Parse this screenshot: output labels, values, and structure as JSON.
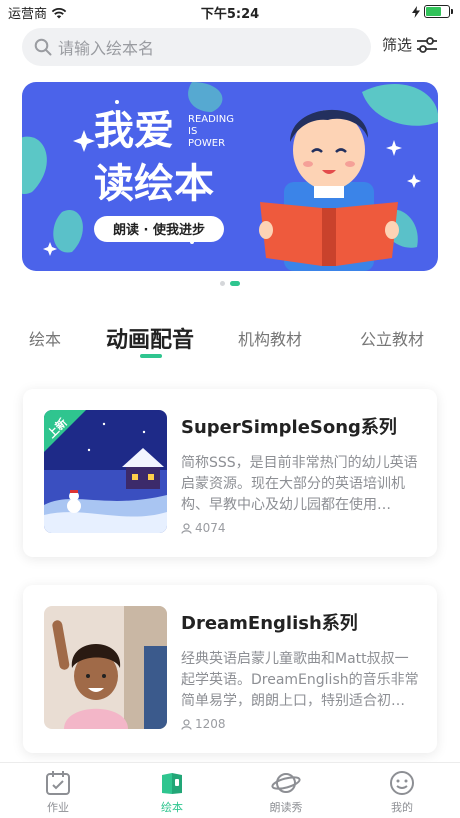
{
  "status_bar": {
    "carrier": "运营商",
    "time": "下午5:24"
  },
  "search": {
    "placeholder": "请输入绘本名",
    "filter_label": "筛选"
  },
  "banner": {
    "title_line1": "我爱",
    "title_line2": "读绘本",
    "slogan_en_1": "READING",
    "slogan_en_2": "IS",
    "slogan_en_3": "POWER",
    "pill_text": "朗读 · 使我进步",
    "active_page": 2,
    "page_count": 2
  },
  "tabs": [
    {
      "label": "绘本",
      "active": false
    },
    {
      "label": "动画配音",
      "active": true
    },
    {
      "label": "机构教材",
      "active": false
    },
    {
      "label": "公立教材",
      "active": false
    }
  ],
  "cards": [
    {
      "badge": "上新",
      "title": "SuperSimpleSong系列",
      "description": "简称SSS，是目前非常热门的幼儿英语启蒙资源。现在大部分的英语培训机构、早教中心及幼儿园都在使用…",
      "count": "4074"
    },
    {
      "title": "DreamEnglish系列",
      "description": "经典英语启蒙儿童歌曲和Matt叔叔一起学英语。DreamEnglish的音乐非常简单易学，朗朗上口，特别适合初…",
      "count": "1208"
    }
  ],
  "tabbar": [
    {
      "label": "作业",
      "icon": "homework-calendar-icon",
      "active": false
    },
    {
      "label": "绘本",
      "icon": "picture-book-icon",
      "active": true
    },
    {
      "label": "朗读秀",
      "icon": "planet-icon",
      "active": false
    },
    {
      "label": "我的",
      "icon": "smiley-face-icon",
      "active": false
    }
  ],
  "colors": {
    "accent": "#2fc58f",
    "banner_bg": "#4b63ea"
  }
}
